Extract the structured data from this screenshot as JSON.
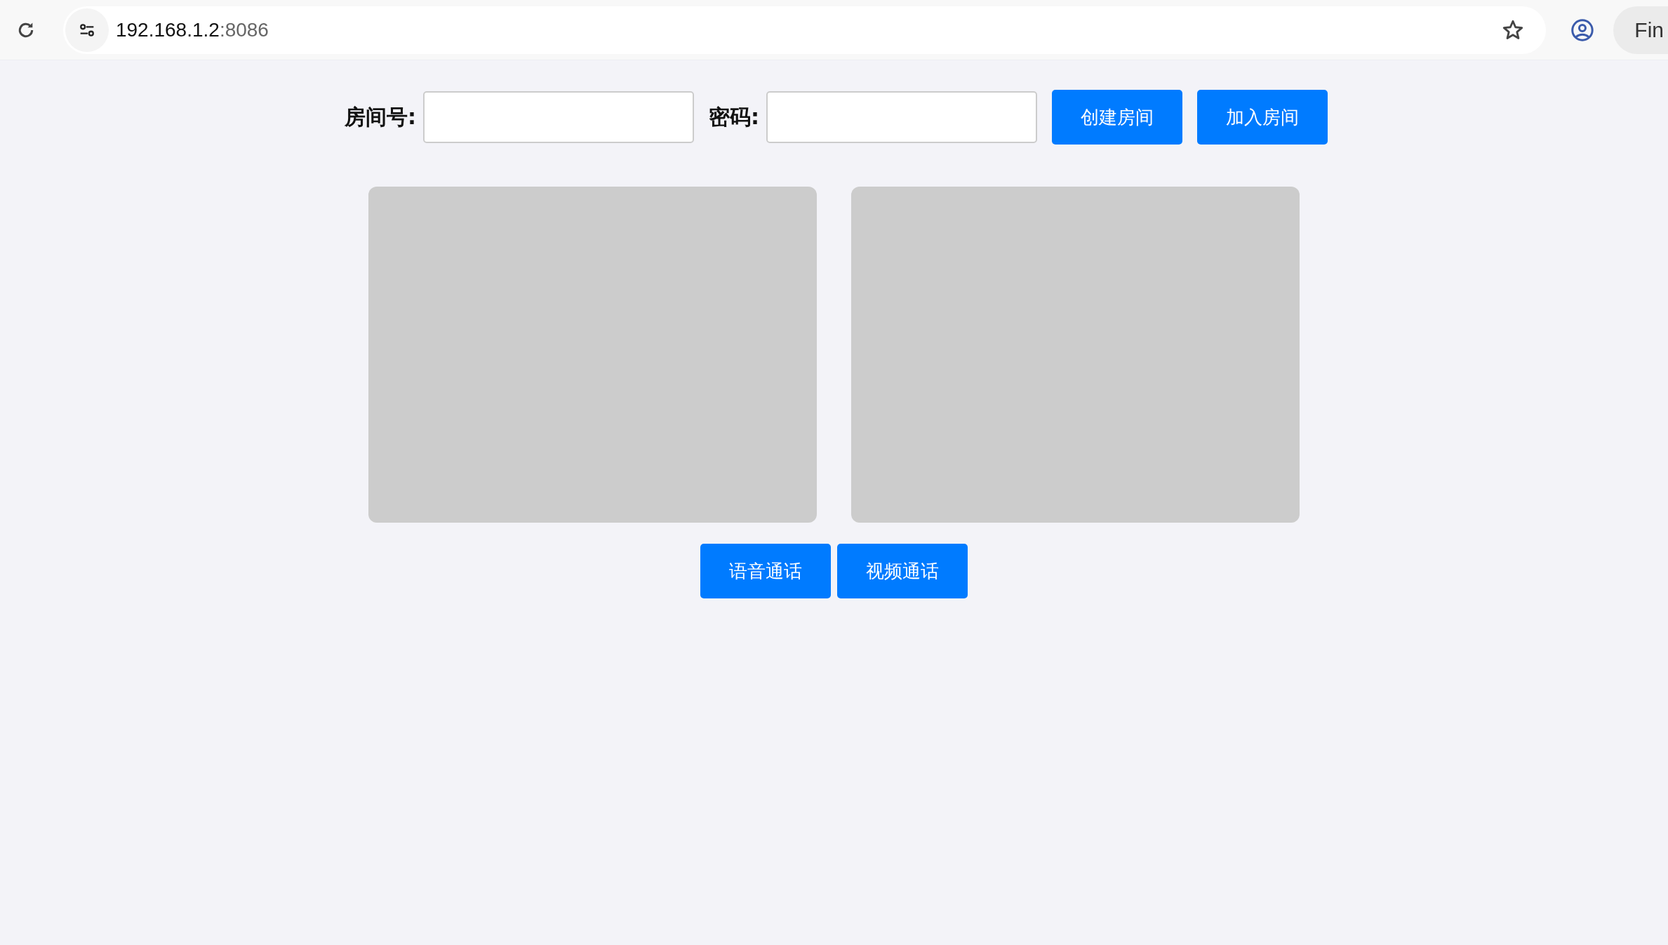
{
  "browser": {
    "url_host": "192.168.1.2",
    "url_port": ":8086",
    "chip": "Fin"
  },
  "form": {
    "room_label": "房间号:",
    "password_label": "密码:",
    "buttons": [
      "创建房间",
      "加入房间"
    ]
  },
  "call_buttons": [
    "语音通话",
    "视频通话"
  ]
}
